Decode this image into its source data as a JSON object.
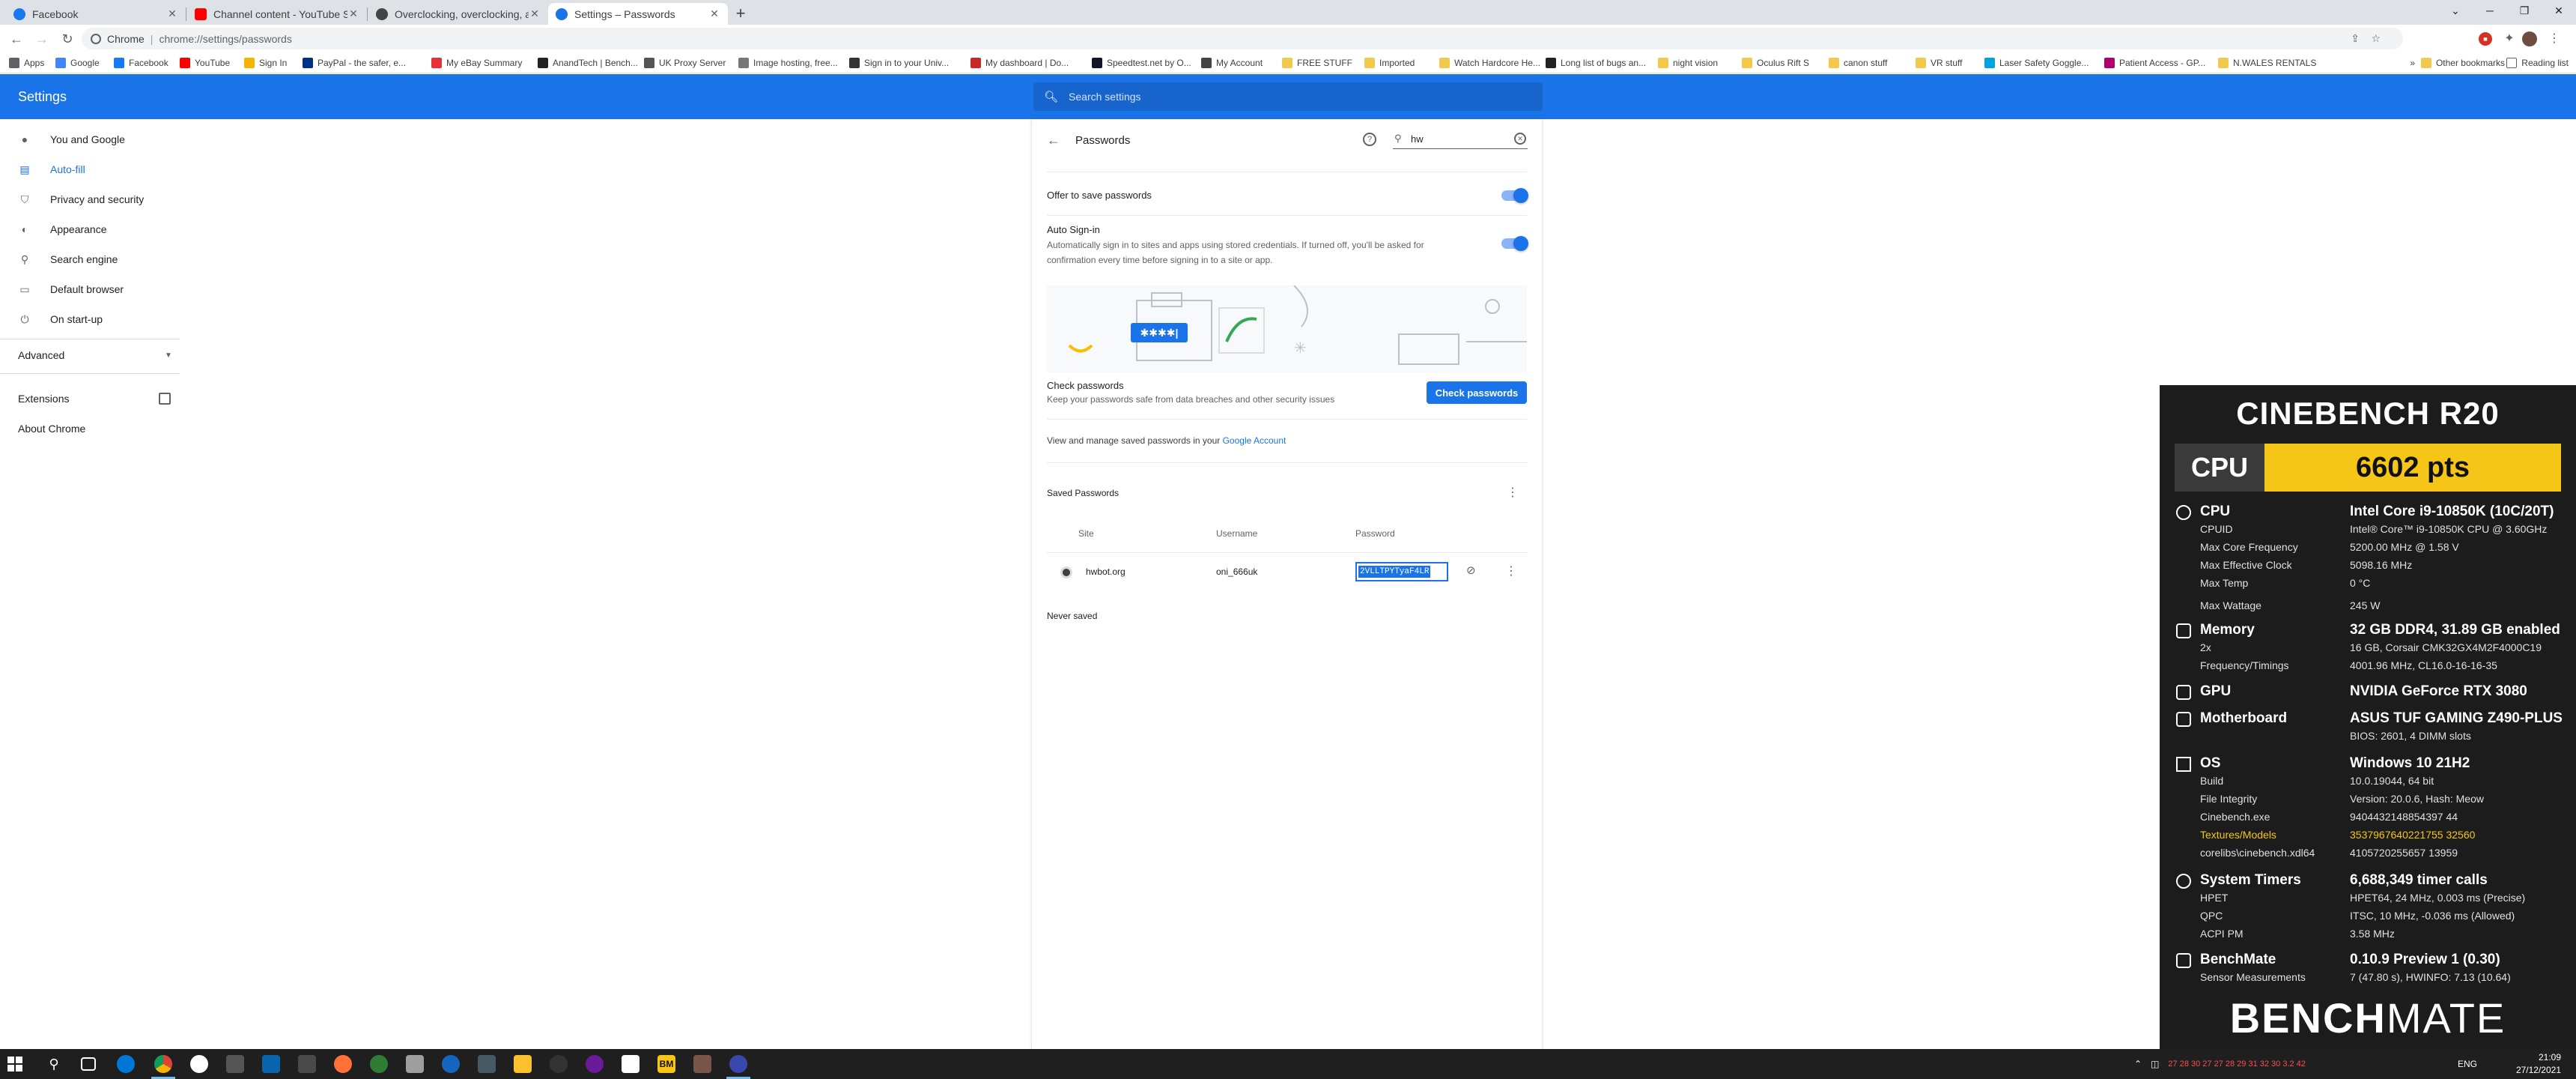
{
  "window": {
    "tabs": [
      {
        "title": "Facebook",
        "color": "#1877f2"
      },
      {
        "title": "Channel content - YouTube Studi",
        "color": "#ff0000"
      },
      {
        "title": "Overclocking, overclocking, and",
        "color": "#444444"
      },
      {
        "title": "Settings – Passwords",
        "color": "#1a73e8"
      }
    ],
    "new_tab": "+",
    "controls": [
      "⌄",
      "─",
      "❐",
      "✕"
    ]
  },
  "toolbar": {
    "chip": "Chrome",
    "separator": "|",
    "url": "chrome://settings/passwords"
  },
  "bookmarks": [
    {
      "label": "Apps",
      "color": "#5f6368"
    },
    {
      "label": "Google",
      "color": "#4285f4"
    },
    {
      "label": "Facebook",
      "color": "#1877f2"
    },
    {
      "label": "YouTube",
      "color": "#ff0000"
    },
    {
      "label": "Sign In",
      "color": "#f4b400"
    },
    {
      "label": "PayPal - the safer, e...",
      "color": "#003087"
    },
    {
      "label": "My eBay Summary",
      "color": "#e53238"
    },
    {
      "label": "AnandTech | Bench...",
      "color": "#222222"
    },
    {
      "label": "UK Proxy Server",
      "color": "#555555"
    },
    {
      "label": "Image hosting, free...",
      "color": "#777777"
    },
    {
      "label": "Sign in to your Univ...",
      "color": "#333333"
    },
    {
      "label": "My dashboard | Do...",
      "color": "#c62828"
    },
    {
      "label": "Speedtest.net by O...",
      "color": "#141526"
    },
    {
      "label": "My Account",
      "color": "#444444"
    },
    {
      "label": "FREE STUFF",
      "color": "#f2c94c"
    },
    {
      "label": "Imported",
      "color": "#f2c94c"
    },
    {
      "label": "Watch Hardcore He...",
      "color": "#f2c94c"
    },
    {
      "label": "Long list of bugs an...",
      "color": "#222222"
    },
    {
      "label": "night vision",
      "color": "#f2c94c"
    },
    {
      "label": "Oculus Rift S",
      "color": "#f2c94c"
    },
    {
      "label": "canon stuff",
      "color": "#f2c94c"
    },
    {
      "label": "VR stuff",
      "color": "#f2c94c"
    },
    {
      "label": "Laser Safety Goggle...",
      "color": "#00a3e0"
    },
    {
      "label": "Patient Access - GP...",
      "color": "#b0006d"
    },
    {
      "label": "N.WALES RENTALS",
      "color": "#f2c94c"
    }
  ],
  "bookmarks_right": {
    "more": "»",
    "other": "Other bookmarks",
    "reading": "Reading list"
  },
  "settings": {
    "title": "Settings",
    "search_placeholder": "Search settings",
    "nav": [
      {
        "label": "You and Google",
        "icon": "👤"
      },
      {
        "label": "Auto-fill",
        "icon": "📄"
      },
      {
        "label": "Privacy and security",
        "icon": "🛡"
      },
      {
        "label": "Appearance",
        "icon": "🎨"
      },
      {
        "label": "Search engine",
        "icon": "🔍"
      },
      {
        "label": "Default browser",
        "icon": "▭"
      },
      {
        "label": "On start-up",
        "icon": "⏻"
      }
    ],
    "advanced": "Advanced",
    "extensions": "Extensions",
    "about": "About Chrome"
  },
  "passwords": {
    "title": "Passwords",
    "filter_value": "hw",
    "offer_to_save": "Offer to save passwords",
    "auto_signin_title": "Auto Sign-in",
    "auto_signin_desc": "Automatically sign in to sites and apps using stored credentials. If turned off, you'll be asked for confirmation every time before signing in to a site or app.",
    "illustration_dots": "✱✱✱✱|",
    "check_title": "Check passwords",
    "check_desc": "Keep your passwords safe from data breaches and other security issues",
    "check_button": "Check passwords",
    "manage_text": "View and manage saved passwords in your",
    "manage_link": "Google Account",
    "saved_title": "Saved Passwords",
    "columns": {
      "site": "Site",
      "username": "Username",
      "password": "Password"
    },
    "rows": [
      {
        "site": "hwbot.org",
        "username": "oni_666uk",
        "password": "2VLLTPYTyaF4LR"
      }
    ],
    "never_saved": "Never saved"
  },
  "cinebench": {
    "title": "CINEBENCH R20",
    "score_label": "CPU",
    "score_value": "6602 pts",
    "cpu": {
      "label": "CPU",
      "value": "Intel Core i9-10850K (10C/20T)",
      "rows": [
        {
          "k": "CPUID",
          "v": "Intel® Core™ i9-10850K CPU @ 3.60GHz"
        },
        {
          "k": "Max Core Frequency",
          "v": "5200.00 MHz @ 1.58 V"
        },
        {
          "k": "Max Effective Clock",
          "v": "5098.16 MHz"
        },
        {
          "k": "Max Temp",
          "v": "0 °C"
        },
        {
          "k": "Max Wattage",
          "v": "245 W"
        }
      ]
    },
    "memory": {
      "label": "Memory",
      "value": "32 GB DDR4, 31.89 GB enabled",
      "rows": [
        {
          "k": "2x",
          "v": "16 GB, Corsair CMK32GX4M2F4000C19"
        },
        {
          "k": "Frequency/Timings",
          "v": "4001.96 MHz, CL16.0-16-16-35"
        }
      ]
    },
    "gpu": {
      "label": "GPU",
      "value": "NVIDIA GeForce RTX 3080"
    },
    "motherboard": {
      "label": "Motherboard",
      "value": "ASUS TUF GAMING Z490-PLUS",
      "rows": [
        {
          "k": "",
          "v": "BIOS: 2601, 4 DIMM slots"
        }
      ]
    },
    "os": {
      "label": "OS",
      "value": "Windows 10 21H2",
      "rows": [
        {
          "k": "Build",
          "v": "10.0.19044, 64 bit"
        },
        {
          "k": "File Integrity",
          "v": "Version: 20.0.6, Hash: Meow"
        },
        {
          "k": "Cinebench.exe",
          "v": "9404432148854397 44"
        },
        {
          "k": "Textures/Models",
          "v": "3537967640221755 32560"
        },
        {
          "k": "corelibs\\cinebench.xdl64",
          "v": "4105720255657 13959"
        }
      ]
    },
    "timers": {
      "label": "System Timers",
      "value": "6,688,349 timer calls",
      "rows": [
        {
          "k": "HPET",
          "v": "HPET64, 24 MHz, 0.003 ms (Precise)"
        },
        {
          "k": "QPC",
          "v": "ITSC, 10 MHz, -0.036 ms (Allowed)"
        },
        {
          "k": "ACPI PM",
          "v": "3.58 MHz"
        }
      ]
    },
    "benchmate": {
      "label": "BenchMate",
      "value": "0.10.9 Preview 1 (0.30)",
      "rows": [
        {
          "k": "Sensor Measurements",
          "v": "7 (47.80 s), HWINFO: 7.13 (10.64)"
        }
      ]
    },
    "logo_bold": "BENCH",
    "logo_light": "MATE",
    "highlight_color": "#f5c518"
  },
  "taskbar": {
    "temps": "27  28  30  27  27  28  29  31  32  30  3.2  42",
    "lang": "ENG",
    "time": "21:09",
    "date": "27/12/2021"
  }
}
